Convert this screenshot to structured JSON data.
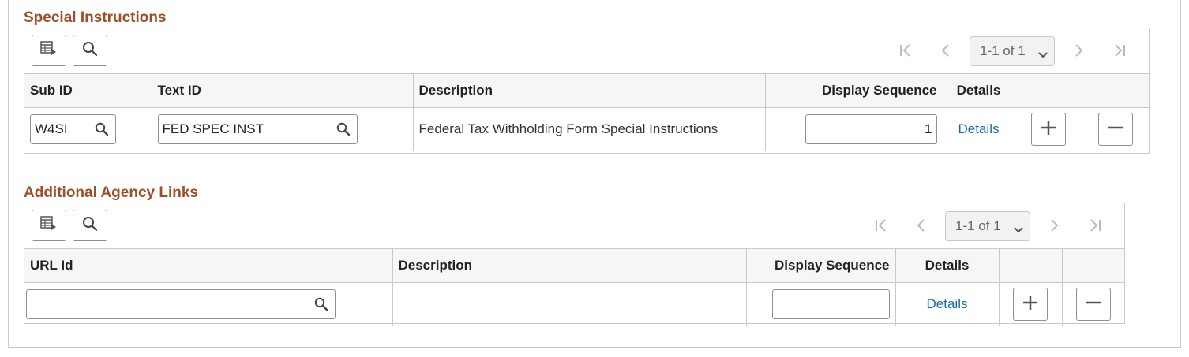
{
  "special_instructions": {
    "title": "Special Instructions",
    "pager": {
      "range": "1-1 of 1"
    },
    "columns": [
      "Sub ID",
      "Text ID",
      "Description",
      "Display Sequence",
      "Details"
    ],
    "row": {
      "sub_id": "W4SI",
      "text_id": "FED SPEC INST",
      "description": "Federal Tax Withholding Form Special Instructions",
      "display_sequence": "1",
      "details_link": "Details"
    }
  },
  "additional_agency_links": {
    "title": "Additional Agency Links",
    "pager": {
      "range": "1-1 of 1"
    },
    "columns": [
      "URL Id",
      "Description",
      "Display Sequence",
      "Details"
    ],
    "row": {
      "url_id": "",
      "description": "",
      "display_sequence": "",
      "details_link": "Details"
    }
  },
  "icons": {
    "toolbar": [
      "personalize-grid-icon",
      "find-icon"
    ],
    "pager": [
      "first-page-icon",
      "previous-page-icon",
      "chevron-down-icon",
      "next-page-icon",
      "last-page-icon"
    ],
    "row": [
      "lookup-icon",
      "add-row-icon",
      "delete-row-icon"
    ]
  },
  "colors": {
    "section_title": "#9e4f27",
    "link": "#1a6aa8",
    "border": "#c9c9c9",
    "header_bg": "#f7f6f5"
  }
}
